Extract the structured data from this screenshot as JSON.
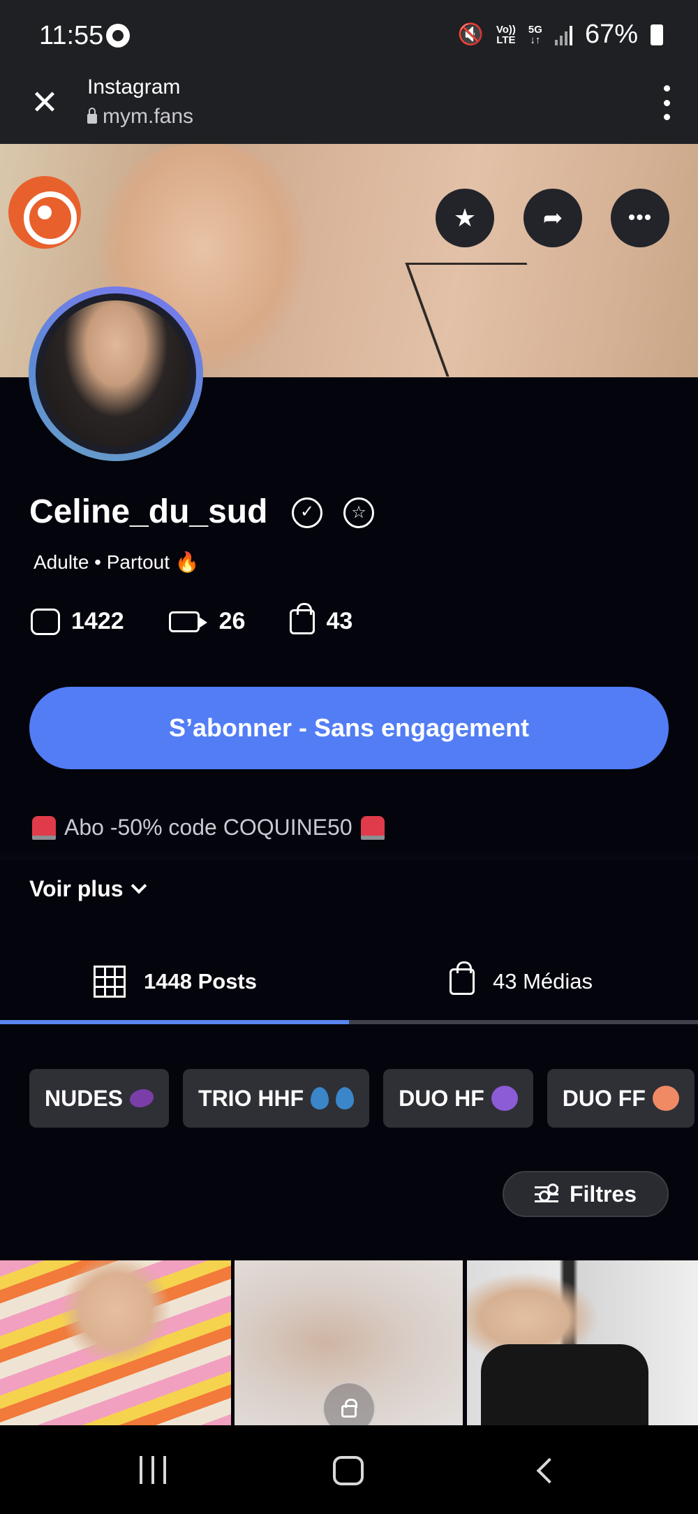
{
  "status_bar": {
    "time": "11:55",
    "network_top": "Vo))",
    "network_bottom": "LTE",
    "gen_top": "5G",
    "gen_bottom": "↓↑",
    "battery": "67%"
  },
  "browser": {
    "title": "Instagram",
    "url": "mym.fans"
  },
  "profile": {
    "name": "Celine_du_sud",
    "subtitle": "Adulte • Partout 🔥",
    "stats": [
      {
        "icon": "photo-icon",
        "value": "1422"
      },
      {
        "icon": "video-icon",
        "value": "26"
      },
      {
        "icon": "bag-icon",
        "value": "43"
      }
    ],
    "subscribe_label": "S’abonner - Sans engagement",
    "promo": "Abo -50% code COQUINE50",
    "voir_plus": "Voir plus"
  },
  "tabs": [
    {
      "label": "1448 Posts",
      "icon": "grid-icon",
      "active": true
    },
    {
      "label": "43 Médias",
      "icon": "bag-icon",
      "active": false
    }
  ],
  "chips": [
    {
      "label": "NUDES",
      "emoji": "eggplant"
    },
    {
      "label": "TRIO HHF",
      "emoji": "sweat-droplets"
    },
    {
      "label": "DUO HF",
      "emoji": "smiling-devil"
    },
    {
      "label": "DUO FF",
      "emoji": "peach"
    }
  ],
  "filters_label": "Filtres",
  "colors": {
    "background": "#03040c",
    "accent": "#527df5",
    "chip": "#2f3036",
    "brand_logo": "#e8612d"
  }
}
